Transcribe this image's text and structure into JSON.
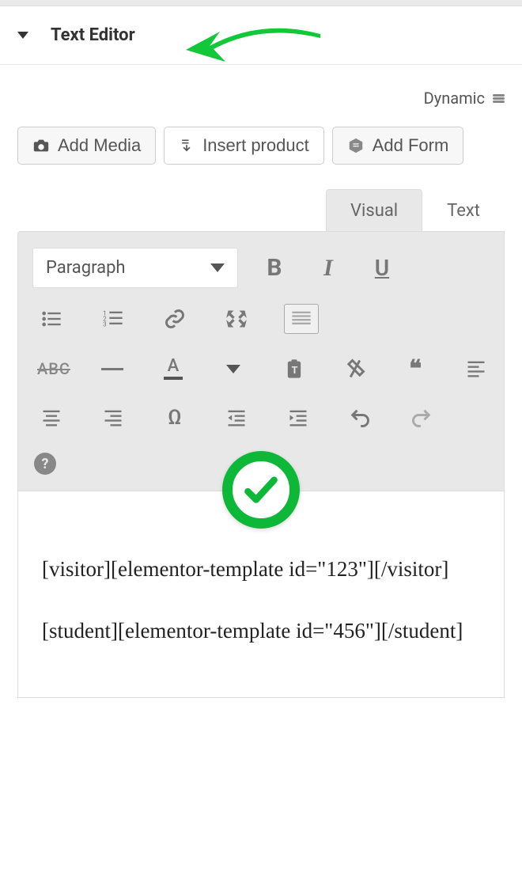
{
  "header": {
    "title": "Text Editor"
  },
  "dynamic": {
    "label": "Dynamic"
  },
  "buttons": {
    "add_media": "Add Media",
    "insert_product": "Insert product",
    "add_form": "Add Form"
  },
  "tabs": {
    "visual": "Visual",
    "text": "Text"
  },
  "toolbar": {
    "format_select": "Paragraph",
    "bold": "B",
    "italic": "I",
    "underline": "U",
    "strike_label": "ABC",
    "color_letter": "A",
    "omega": "Ω",
    "help": "?"
  },
  "editor": {
    "paragraphs": [
      "[visitor][elementor-template id=\"123\"][/visitor]",
      "[student][elementor-template id=\"456\"][/student]"
    ]
  },
  "colors": {
    "arrow": "#10c838",
    "check": "#0db737"
  }
}
